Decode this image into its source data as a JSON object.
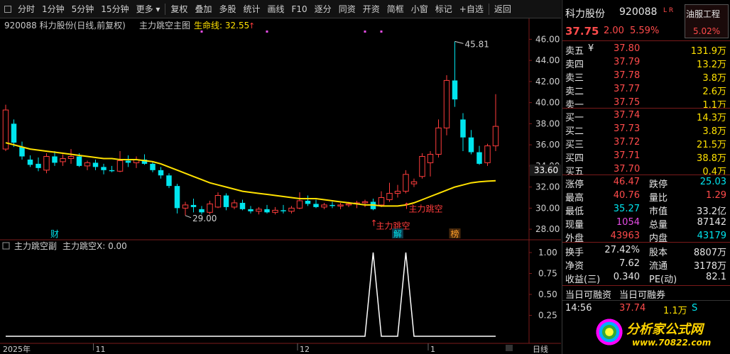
{
  "toolbar": {
    "items": [
      "分时",
      "1分钟",
      "5分钟",
      "15分钟",
      "更多",
      "复权",
      "叠加",
      "多股",
      "统计",
      "画线",
      "F10",
      "逐分",
      "同资",
      "开资",
      "简框",
      "小窗",
      "标记",
      "+自选",
      "返回"
    ]
  },
  "chart_header": {
    "title": "920088 科力股份(日线,前复权)",
    "indicator": "主力跳空主图",
    "lifeline": "生命线: 32.55",
    "watermark": "分析家公式网HTTP://WWW.70822.COM"
  },
  "sub_header": {
    "name": "主力跳空副",
    "value": "主力跳空X: 0.00"
  },
  "colors": {
    "up": "#ff3c3c",
    "down": "#00e5ee",
    "ma": "#ffe100",
    "grid": "#7a1a1a"
  },
  "chart_data": {
    "type": "candlestick",
    "y_ticks": [
      "46.00",
      "44.00",
      "42.00",
      "40.00",
      "38.00",
      "36.00",
      "34.00",
      "32.00",
      "30.00",
      "28.00"
    ],
    "y_range": [
      27,
      46.9
    ],
    "x_labels": [
      "2025年",
      "11",
      "12",
      "1"
    ],
    "last_price_label": "33.60",
    "high_label": "45.81",
    "low_label": "29.00",
    "signal_label": "主力跳空",
    "markers": [
      "财",
      "解",
      "榜"
    ],
    "sub_y_ticks": [
      "1.00",
      "0.75",
      "0.50",
      "0.25"
    ],
    "period_label": "日线",
    "candles": [
      [
        35.6,
        39.8,
        35.4,
        39.3
      ],
      [
        38.0,
        38.4,
        35.8,
        36.2
      ],
      [
        35.8,
        36.3,
        34.6,
        34.9
      ],
      [
        34.6,
        35.0,
        33.9,
        34.1
      ],
      [
        34.2,
        34.8,
        33.5,
        33.8
      ],
      [
        33.6,
        35.2,
        33.3,
        34.9
      ],
      [
        34.9,
        35.4,
        34.0,
        34.3
      ],
      [
        34.4,
        35.1,
        34.0,
        34.7
      ],
      [
        34.7,
        35.6,
        34.2,
        34.9
      ],
      [
        34.9,
        35.2,
        33.9,
        34.0
      ],
      [
        34.0,
        34.5,
        33.6,
        34.3
      ],
      [
        34.3,
        34.6,
        33.6,
        33.9
      ],
      [
        33.9,
        34.2,
        33.2,
        33.6
      ],
      [
        33.6,
        34.0,
        33.4,
        33.5
      ],
      [
        33.5,
        35.4,
        33.4,
        34.5
      ],
      [
        34.5,
        35.0,
        33.9,
        34.3
      ],
      [
        34.3,
        34.9,
        33.8,
        34.6
      ],
      [
        34.6,
        35.1,
        34.1,
        34.2
      ],
      [
        34.2,
        34.4,
        33.4,
        33.6
      ],
      [
        33.6,
        33.9,
        32.8,
        33.1
      ],
      [
        33.1,
        33.3,
        31.9,
        32.1
      ],
      [
        32.1,
        32.3,
        29.5,
        30.0
      ],
      [
        30.0,
        30.6,
        29.3,
        30.3
      ],
      [
        30.3,
        30.9,
        29.6,
        30.1
      ],
      [
        29.9,
        30.2,
        29.4,
        29.6
      ],
      [
        29.6,
        30.7,
        29.4,
        30.4
      ],
      [
        30.1,
        31.5,
        30.0,
        31.2
      ],
      [
        31.2,
        31.4,
        29.8,
        30.1
      ],
      [
        30.1,
        30.8,
        29.9,
        30.5
      ],
      [
        30.5,
        30.8,
        29.8,
        29.9
      ],
      [
        29.9,
        30.2,
        29.5,
        29.7
      ],
      [
        29.7,
        30.1,
        29.4,
        29.9
      ],
      [
        29.9,
        30.3,
        29.5,
        29.6
      ],
      [
        29.6,
        30.1,
        29.4,
        29.8
      ],
      [
        29.8,
        30.3,
        29.5,
        29.7
      ],
      [
        29.7,
        30.2,
        29.5,
        30.0
      ],
      [
        30.0,
        31.5,
        29.9,
        30.7
      ],
      [
        30.7,
        31.2,
        30.2,
        30.4
      ],
      [
        30.4,
        30.8,
        30.0,
        30.1
      ],
      [
        30.1,
        30.5,
        29.9,
        30.3
      ],
      [
        30.3,
        30.6,
        30.0,
        30.2
      ],
      [
        30.2,
        30.5,
        29.9,
        30.3
      ],
      [
        30.3,
        30.6,
        30.1,
        30.4
      ],
      [
        30.4,
        30.7,
        30.0,
        30.5
      ],
      [
        30.5,
        30.8,
        30.1,
        30.6
      ],
      [
        30.6,
        30.9,
        29.8,
        29.9
      ],
      [
        30.3,
        31.6,
        30.1,
        31.0
      ],
      [
        30.8,
        32.4,
        30.6,
        31.4
      ],
      [
        31.4,
        32.2,
        31.0,
        31.6
      ],
      [
        31.6,
        33.6,
        31.4,
        33.2
      ],
      [
        32.3,
        32.8,
        32.0,
        32.5
      ],
      [
        33.0,
        35.2,
        32.8,
        34.9
      ],
      [
        34.3,
        35.4,
        33.0,
        35.1
      ],
      [
        35.1,
        38.4,
        34.8,
        37.6
      ],
      [
        37.6,
        42.6,
        36.9,
        42.1
      ],
      [
        42.1,
        45.8,
        39.6,
        40.3
      ],
      [
        38.4,
        39.0,
        35.4,
        36.7
      ],
      [
        36.7,
        37.4,
        35.1,
        35.3
      ],
      [
        35.3,
        35.9,
        34.1,
        34.2
      ],
      [
        34.3,
        36.1,
        34.0,
        35.9
      ],
      [
        35.9,
        40.8,
        35.4,
        37.75
      ]
    ],
    "ma": [
      36.2,
      36.0,
      35.8,
      35.6,
      35.5,
      35.4,
      35.3,
      35.2,
      35.1,
      35.0,
      34.9,
      34.8,
      34.7,
      34.7,
      34.6,
      34.6,
      34.6,
      34.5,
      34.4,
      34.2,
      33.9,
      33.6,
      33.3,
      33.0,
      32.7,
      32.4,
      32.2,
      32.0,
      31.8,
      31.6,
      31.5,
      31.4,
      31.3,
      31.2,
      31.1,
      31.0,
      30.9,
      30.9,
      30.9,
      30.8,
      30.7,
      30.6,
      30.5,
      30.4,
      30.3,
      30.3,
      30.2,
      30.2,
      30.2,
      30.3,
      30.5,
      30.8,
      31.1,
      31.4,
      31.7,
      32.0,
      32.2,
      32.4,
      32.5,
      32.55,
      32.6
    ],
    "sub_values": [
      0,
      0,
      0,
      0,
      0,
      0,
      0,
      0,
      0,
      0,
      0,
      0,
      0,
      0,
      0,
      0,
      0,
      0,
      0,
      0,
      0,
      0,
      0,
      0,
      0,
      0,
      0,
      0,
      0,
      0,
      0,
      0,
      0,
      0,
      0,
      0,
      0,
      0,
      0,
      0,
      0,
      0,
      0,
      0,
      0,
      1,
      0,
      0,
      0,
      1,
      0,
      0,
      0,
      0,
      0,
      0,
      0,
      0,
      0,
      0,
      0
    ]
  },
  "panel": {
    "name": "科力股份",
    "code": "920088",
    "tags": "L R",
    "price": "37.75",
    "change": "2.00",
    "change_pct": "5.59%",
    "sector": "油服工程",
    "sector_pct": "5.02%",
    "asks": [
      {
        "label": "卖五",
        "mark": "¥",
        "price": "37.80",
        "vol": "131.9万"
      },
      {
        "label": "卖四",
        "mark": "",
        "price": "37.79",
        "vol": "13.2万"
      },
      {
        "label": "卖三",
        "mark": "",
        "price": "37.78",
        "vol": "3.8万"
      },
      {
        "label": "卖二",
        "mark": "",
        "price": "37.77",
        "vol": "2.6万"
      },
      {
        "label": "卖一",
        "mark": "",
        "price": "37.75",
        "vol": "1.1万"
      }
    ],
    "bids": [
      {
        "label": "买一",
        "price": "37.74",
        "vol": "14.3万"
      },
      {
        "label": "买二",
        "price": "37.73",
        "vol": "3.8万"
      },
      {
        "label": "买三",
        "price": "37.72",
        "vol": "21.5万"
      },
      {
        "label": "买四",
        "price": "37.71",
        "vol": "38.8万"
      },
      {
        "label": "买五",
        "price": "37.70",
        "vol": "0.4万"
      }
    ],
    "stats1": [
      {
        "l1": "涨停",
        "v1": "46.47",
        "l2": "跌停",
        "v2": "25.03"
      },
      {
        "l1": "最高",
        "v1": "40.76",
        "l2": "量比",
        "v2": "1.29"
      },
      {
        "l1": "最低",
        "v1": "35.27",
        "l2": "市值",
        "v2": "33.2亿"
      },
      {
        "l1": "现量",
        "v1": "1054",
        "l2": "总量",
        "v2": "87142"
      },
      {
        "l1": "外盘",
        "v1": "43963",
        "l2": "内盘",
        "v2": "43179"
      }
    ],
    "stats2": [
      {
        "l1": "换手",
        "v1": "27.42%",
        "l2": "股本",
        "v2": "8807万"
      },
      {
        "l1": "净资",
        "v1": "7.62",
        "l2": "流通",
        "v2": "3178万"
      },
      {
        "l1": "收益(三)",
        "v1": "0.340",
        "l2": "PE(动)",
        "v2": "82.1"
      }
    ],
    "finance_label1": "当日可融资",
    "finance_label2": "当日可融券",
    "tick": {
      "time": "14:56",
      "price": "37.74",
      "vol": "1.1万",
      "side": "S"
    },
    "logo": "分析家公式网",
    "logo_url": "www.70822.com"
  }
}
